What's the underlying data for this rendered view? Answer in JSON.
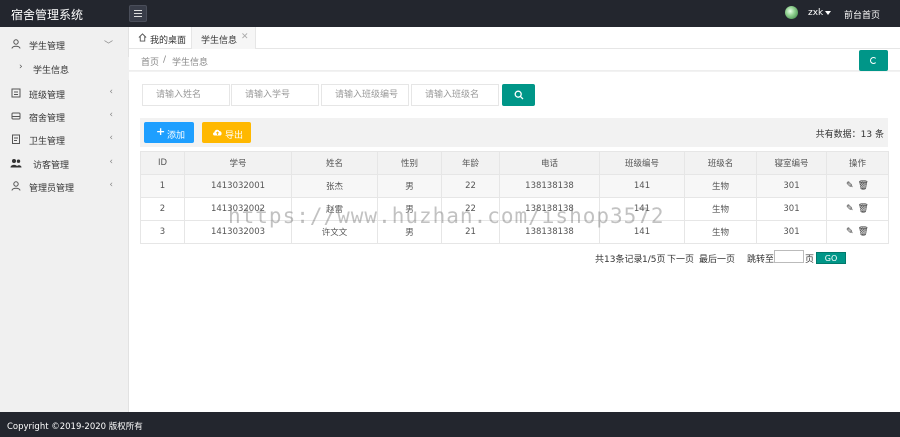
{
  "header": {
    "logo": "宿舍管理系统",
    "username": "zxk",
    "front_link": "前台首页"
  },
  "sidebar": {
    "items": [
      {
        "label": "学生管理",
        "icon": "user-icon"
      },
      {
        "label": "学生信息",
        "icon": "chevron-right-icon"
      },
      {
        "label": "班级管理",
        "icon": "list-icon"
      },
      {
        "label": "宿舍管理",
        "icon": "bed-icon"
      },
      {
        "label": "卫生管理",
        "icon": "clipboard-icon"
      },
      {
        "label": "访客管理",
        "icon": "users-icon"
      },
      {
        "label": "管理员管理",
        "icon": "user-icon"
      }
    ]
  },
  "tabs": [
    {
      "label": "我的桌面"
    },
    {
      "label": "学生信息"
    }
  ],
  "breadcrumb": {
    "home": "首页",
    "sep": "/",
    "current": "学生信息"
  },
  "search": {
    "name_placeholder": "请输入姓名",
    "id_placeholder": "请输入学号",
    "class_no_placeholder": "请输入班级编号",
    "class_name_placeholder": "请输入班级名"
  },
  "toolbar": {
    "add_label": "添加",
    "export_label": "导出",
    "total_label": "共有数据：13 条"
  },
  "table": {
    "headers": [
      "ID",
      "学号",
      "姓名",
      "性别",
      "年龄",
      "电话",
      "班级编号",
      "班级名",
      "寝室编号",
      "操作"
    ],
    "rows": [
      [
        "1",
        "1413032001",
        "张杰",
        "男",
        "22",
        "138138138",
        "141",
        "生物",
        "301"
      ],
      [
        "2",
        "1413032002",
        "赵雷",
        "男",
        "22",
        "138138138",
        "141",
        "生物",
        "301"
      ],
      [
        "3",
        "1413032003",
        "许文文",
        "男",
        "21",
        "138138138",
        "141",
        "生物",
        "301"
      ]
    ]
  },
  "pager": {
    "records": "共13条记录",
    "pages": "1/5页",
    "next": "下一页",
    "last": "最后一页",
    "jump_to": "跳转至",
    "page_unit": "页",
    "go": "GO"
  },
  "watermark": "https://www.huzhan.com/ishop3572",
  "footer": {
    "copyright": "Copyright ©2019-2020 版权所有"
  },
  "colors": {
    "header_bg": "#23262e",
    "teal": "#009688",
    "blue": "#1e9fff",
    "orange": "#ffb800"
  }
}
